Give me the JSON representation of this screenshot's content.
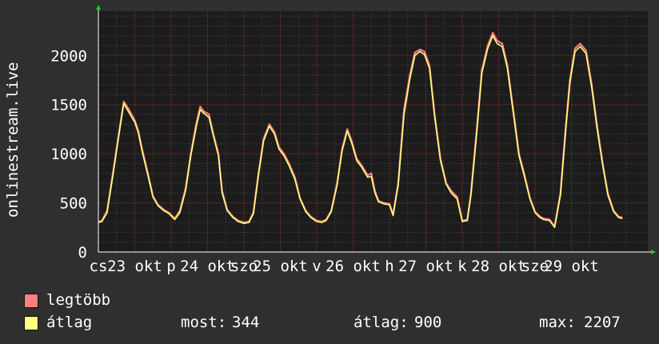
{
  "colors": {
    "background": "#2f2f2f",
    "plot_background": "#1c1c1c",
    "grid": "#8a2d2d",
    "minor_grid": "#4a4a4a",
    "text": "#ffffff",
    "arrow": "#19d219",
    "series_max": "#ff7f7f",
    "series_avg": "#ffff7f"
  },
  "chart_data": {
    "type": "line",
    "title": "",
    "xlabel": "",
    "ylabel": "onlinestream.live",
    "ylim": [
      0,
      2450
    ],
    "yticks": [
      0,
      500,
      1000,
      1500,
      2000
    ],
    "xlim": [
      0,
      7.55
    ],
    "x_tick_labels": [
      {
        "x": 0.0,
        "label": "cs"
      },
      {
        "x": 0.5,
        "label": "23 okt"
      },
      {
        "x": 1.0,
        "label": "p"
      },
      {
        "x": 1.5,
        "label": "24 okt"
      },
      {
        "x": 2.0,
        "label": "szo"
      },
      {
        "x": 2.5,
        "label": "25 okt"
      },
      {
        "x": 3.0,
        "label": "v"
      },
      {
        "x": 3.5,
        "label": "26 okt"
      },
      {
        "x": 4.0,
        "label": "h"
      },
      {
        "x": 4.5,
        "label": "27 okt"
      },
      {
        "x": 5.0,
        "label": "k"
      },
      {
        "x": 5.5,
        "label": "28 okt"
      },
      {
        "x": 6.0,
        "label": "sze"
      },
      {
        "x": 6.5,
        "label": "29 okt"
      }
    ],
    "legend": [
      {
        "name": "legtöbb",
        "color": "#ff7f7f"
      },
      {
        "name": "átlag",
        "color": "#ffff7f"
      }
    ],
    "series": [
      {
        "name": "legtöbb",
        "x": [
          0.0,
          0.05,
          0.12,
          0.2,
          0.28,
          0.35,
          0.42,
          0.5,
          0.55,
          0.6,
          0.68,
          0.75,
          0.82,
          0.9,
          0.97,
          1.05,
          1.12,
          1.2,
          1.27,
          1.35,
          1.4,
          1.45,
          1.52,
          1.58,
          1.65,
          1.7,
          1.77,
          1.85,
          1.92,
          2.0,
          2.07,
          2.13,
          2.2,
          2.27,
          2.35,
          2.42,
          2.48,
          2.55,
          2.62,
          2.7,
          2.77,
          2.85,
          2.92,
          3.0,
          3.07,
          3.13,
          3.2,
          3.28,
          3.35,
          3.42,
          3.48,
          3.55,
          3.62,
          3.7,
          3.75,
          3.8,
          3.85,
          3.92,
          4.0,
          4.05,
          4.12,
          4.2,
          4.28,
          4.35,
          4.42,
          4.48,
          4.55,
          4.62,
          4.7,
          4.78,
          4.85,
          4.93,
          5.0,
          5.07,
          5.12,
          5.2,
          5.27,
          5.35,
          5.42,
          5.48,
          5.55,
          5.62,
          5.7,
          5.78,
          5.85,
          5.93,
          6.0,
          6.07,
          6.12,
          6.2,
          6.27,
          6.35,
          6.42,
          6.48,
          6.55,
          6.62,
          6.7,
          6.78,
          6.85,
          6.93,
          7.0,
          7.08,
          7.15,
          7.2
        ],
        "values": [
          305,
          320,
          420,
          800,
          1200,
          1530,
          1450,
          1340,
          1230,
          1050,
          800,
          570,
          480,
          430,
          400,
          340,
          420,
          650,
          1000,
          1320,
          1480,
          1430,
          1400,
          1200,
          1000,
          620,
          430,
          360,
          320,
          300,
          310,
          400,
          800,
          1150,
          1300,
          1220,
          1070,
          1000,
          900,
          760,
          550,
          420,
          360,
          320,
          310,
          330,
          420,
          700,
          1050,
          1250,
          1130,
          950,
          880,
          780,
          800,
          620,
          520,
          500,
          490,
          380,
          700,
          1450,
          1800,
          2030,
          2060,
          2040,
          1900,
          1400,
          950,
          700,
          620,
          560,
          320,
          330,
          600,
          1250,
          1850,
          2100,
          2230,
          2150,
          2120,
          1900,
          1450,
          1000,
          800,
          550,
          410,
          360,
          340,
          330,
          260,
          600,
          1250,
          1750,
          2070,
          2120,
          2050,
          1700,
          1300,
          900,
          600,
          420,
          360,
          350
        ]
      },
      {
        "name": "átlag",
        "x": [
          0.0,
          0.05,
          0.12,
          0.2,
          0.28,
          0.35,
          0.42,
          0.5,
          0.55,
          0.6,
          0.68,
          0.75,
          0.82,
          0.9,
          0.97,
          1.05,
          1.12,
          1.2,
          1.27,
          1.35,
          1.4,
          1.45,
          1.52,
          1.58,
          1.65,
          1.7,
          1.77,
          1.85,
          1.92,
          2.0,
          2.07,
          2.13,
          2.2,
          2.27,
          2.35,
          2.42,
          2.48,
          2.55,
          2.62,
          2.7,
          2.77,
          2.85,
          2.92,
          3.0,
          3.07,
          3.13,
          3.2,
          3.28,
          3.35,
          3.42,
          3.48,
          3.55,
          3.62,
          3.7,
          3.75,
          3.8,
          3.85,
          3.92,
          4.0,
          4.05,
          4.12,
          4.2,
          4.28,
          4.35,
          4.42,
          4.48,
          4.55,
          4.62,
          4.7,
          4.78,
          4.85,
          4.93,
          5.0,
          5.07,
          5.12,
          5.2,
          5.27,
          5.35,
          5.42,
          5.48,
          5.55,
          5.62,
          5.7,
          5.78,
          5.85,
          5.93,
          6.0,
          6.07,
          6.12,
          6.2,
          6.27,
          6.35,
          6.42,
          6.48,
          6.55,
          6.62,
          6.7,
          6.78,
          6.85,
          6.93,
          7.0,
          7.08,
          7.15,
          7.2
        ],
        "values": [
          300,
          310,
          400,
          780,
          1180,
          1510,
          1420,
          1320,
          1210,
          1030,
          780,
          560,
          470,
          420,
          390,
          330,
          400,
          630,
          980,
          1290,
          1450,
          1410,
          1370,
          1180,
          980,
          600,
          420,
          350,
          310,
          290,
          300,
          390,
          780,
          1130,
          1280,
          1200,
          1050,
          980,
          880,
          740,
          540,
          410,
          350,
          310,
          300,
          320,
          410,
          680,
          1030,
          1230,
          1110,
          930,
          860,
          760,
          770,
          600,
          510,
          490,
          480,
          370,
          680,
          1400,
          1760,
          2000,
          2040,
          2010,
          1870,
          1380,
          930,
          690,
          600,
          540,
          310,
          320,
          580,
          1220,
          1820,
          2070,
          2200,
          2120,
          2090,
          1870,
          1420,
          980,
          780,
          540,
          400,
          350,
          330,
          320,
          250,
          580,
          1220,
          1720,
          2040,
          2090,
          2020,
          1670,
          1270,
          880,
          580,
          410,
          350,
          340
        ]
      }
    ],
    "stats": {
      "now_label": "most:",
      "now_value": "344",
      "avg_label": "átlag:",
      "avg_value": "900",
      "max_label": "max:",
      "max_value": "2207"
    }
  }
}
